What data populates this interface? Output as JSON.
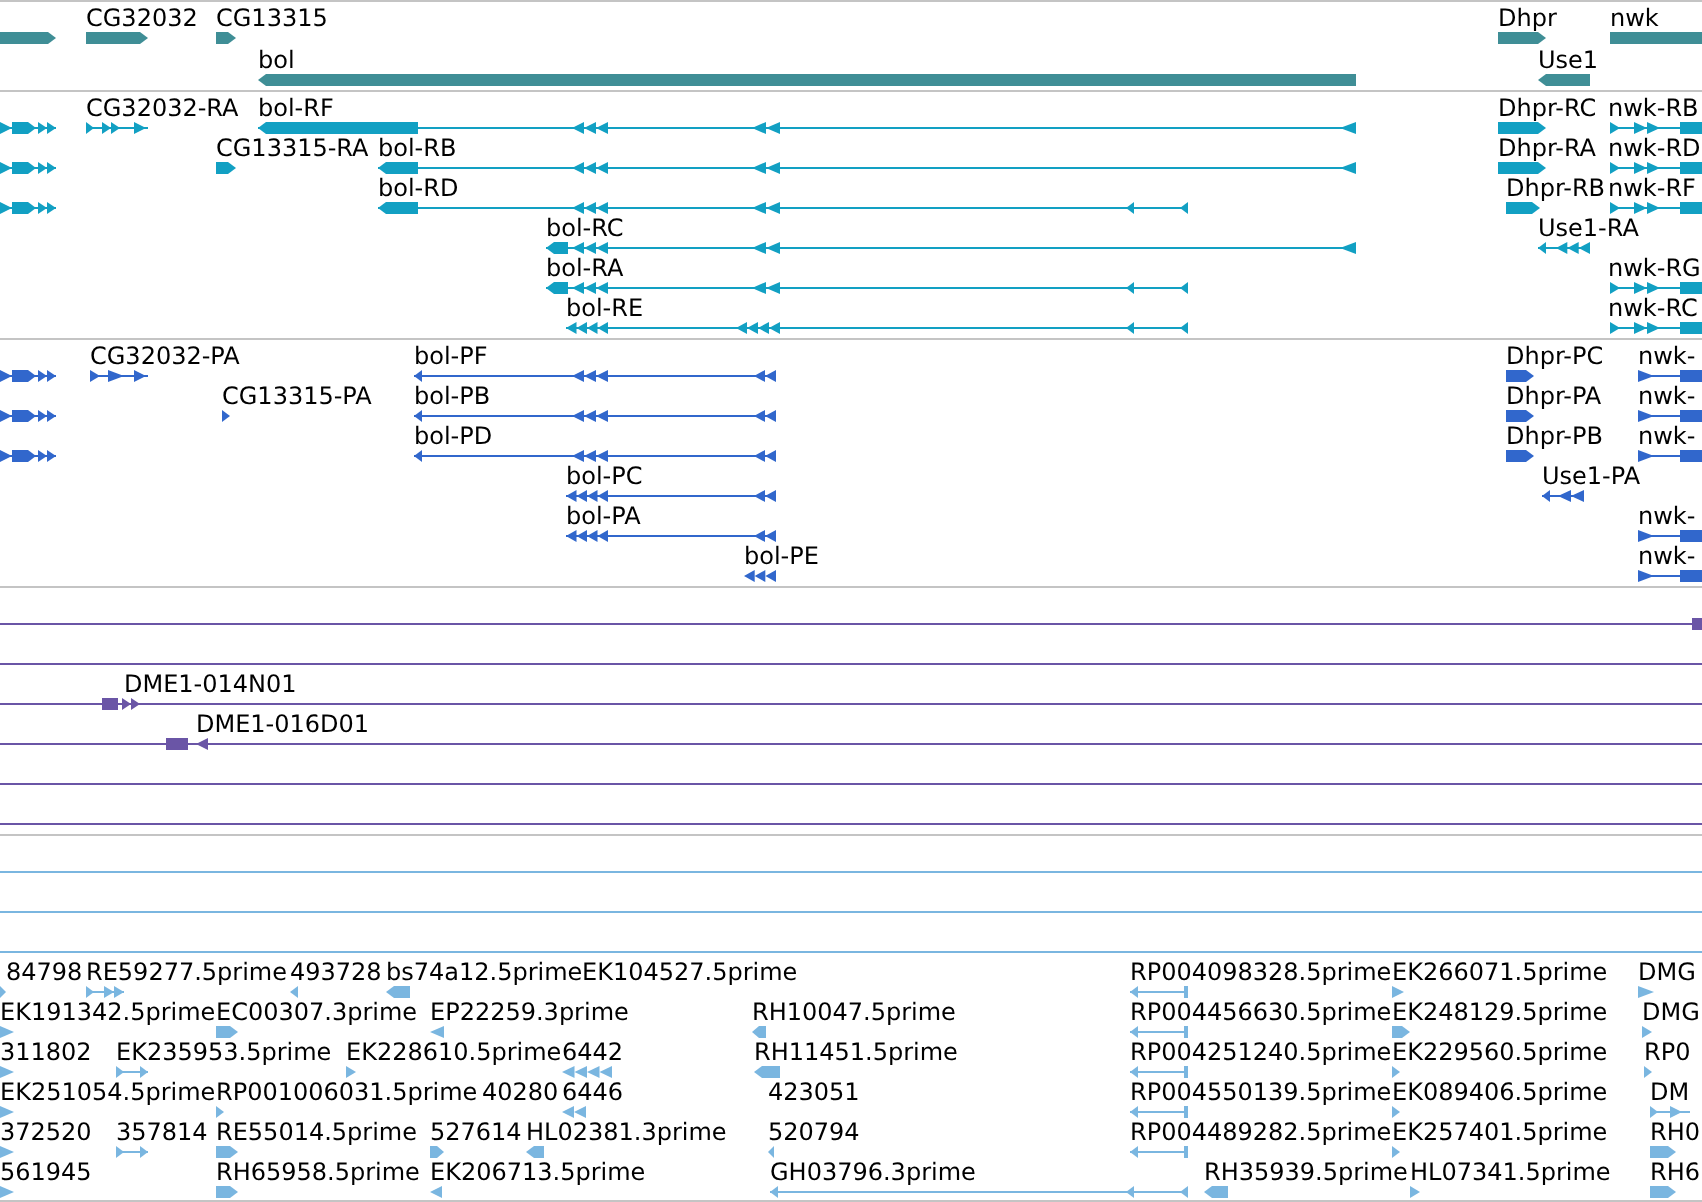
{
  "tracks": [
    {
      "color": "#3f8e96",
      "rows": [
        {
          "features": [
            {
              "reverse": false
            },
            {
              "label": "CG32032",
              "reverse": false
            },
            {
              "label": "CG13315",
              "reverse": false
            },
            {
              "label": "Dhpr",
              "reverse": false
            },
            {
              "label": "nwk",
              "reverse": false
            }
          ]
        },
        {
          "features": [
            {
              "label": "bol",
              "reverse": true
            },
            {
              "label": "Use1",
              "reverse": true
            }
          ]
        }
      ]
    },
    {
      "color": "#12a0c3",
      "rows": [
        {
          "features": [
            {
              "reverse": false
            },
            {
              "label": "CG32032-RA",
              "reverse": false
            },
            {
              "label": "bol-RF",
              "reverse": true
            },
            {
              "label": "Dhpr-RC",
              "reverse": false
            },
            {
              "label": "nwk-RB",
              "reverse": false
            }
          ]
        },
        {
          "features": [
            {
              "reverse": false
            },
            {
              "label": "CG13315-RA",
              "reverse": false
            },
            {
              "label": "bol-RB",
              "reverse": true
            },
            {
              "label": "Dhpr-RA",
              "reverse": false
            },
            {
              "label": "nwk-RD",
              "reverse": false
            }
          ]
        },
        {
          "features": [
            {
              "reverse": false
            },
            {
              "label": "bol-RD",
              "reverse": true
            },
            {
              "label": "Dhpr-RB",
              "reverse": false
            },
            {
              "label": "nwk-RF",
              "reverse": false
            }
          ]
        },
        {
          "features": [
            {
              "label": "bol-RC",
              "reverse": true
            },
            {
              "label": "Use1-RA",
              "reverse": true
            }
          ]
        },
        {
          "features": [
            {
              "label": "bol-RA",
              "reverse": true
            },
            {
              "label": "nwk-RG",
              "reverse": false
            }
          ]
        },
        {
          "features": [
            {
              "label": "bol-RE",
              "reverse": true
            },
            {
              "label": "nwk-RC",
              "reverse": false
            }
          ]
        }
      ]
    },
    {
      "color": "#3167cc",
      "rows": [
        {
          "features": [
            {
              "reverse": false
            },
            {
              "label": "CG32032-PA",
              "reverse": false
            },
            {
              "label": "bol-PF",
              "reverse": true
            },
            {
              "label": "Dhpr-PC",
              "reverse": false
            },
            {
              "label": "nwk-",
              "reverse": false
            }
          ]
        },
        {
          "features": [
            {
              "reverse": false
            },
            {
              "label": "CG13315-PA",
              "reverse": false
            },
            {
              "label": "bol-PB",
              "reverse": true
            },
            {
              "label": "Dhpr-PA",
              "reverse": false
            },
            {
              "label": "nwk-",
              "reverse": false
            }
          ]
        },
        {
          "features": [
            {
              "reverse": false
            },
            {
              "label": "bol-PD",
              "reverse": true
            },
            {
              "label": "Dhpr-PB",
              "reverse": false
            },
            {
              "label": "nwk-",
              "reverse": false
            }
          ]
        },
        {
          "features": [
            {
              "label": "bol-PC",
              "reverse": true
            },
            {
              "label": "Use1-PA",
              "reverse": true
            }
          ]
        },
        {
          "features": [
            {
              "label": "bol-PA",
              "reverse": true
            },
            {
              "label": "nwk-",
              "reverse": false
            }
          ]
        },
        {
          "features": [
            {
              "label": "bol-PE",
              "reverse": true
            },
            {
              "label": "nwk-",
              "reverse": false
            }
          ]
        }
      ]
    },
    {
      "color": "#6a55a6",
      "rows": [
        {
          "features": [
            {
              "kind": "spanning"
            }
          ]
        },
        {
          "features": [
            {
              "kind": "spanning"
            }
          ]
        },
        {
          "features": [
            {
              "kind": "spanning"
            },
            {
              "kind": "feature",
              "label": "DME1-014N01",
              "reverse": false
            }
          ]
        },
        {
          "features": [
            {
              "kind": "spanning"
            },
            {
              "kind": "feature",
              "label": "DME1-016D01",
              "reverse": true
            }
          ]
        },
        {
          "features": [
            {
              "kind": "spanning"
            }
          ]
        },
        {
          "features": [
            {
              "kind": "spanning"
            }
          ]
        }
      ]
    },
    {
      "color": "#7ab6e0",
      "rows": [
        {
          "features": [
            {
              "kind": "spanning"
            }
          ]
        },
        {
          "features": [
            {
              "kind": "spanning"
            }
          ]
        },
        {
          "features": [
            {
              "kind": "spanning"
            }
          ]
        },
        {
          "features": [
            {
              "kind": "feature",
              "label": "84798",
              "reverse": false
            },
            {
              "kind": "feature",
              "label": "RE59277.5prime",
              "reverse": false
            },
            {
              "kind": "feature",
              "label": "493728",
              "reverse": true
            },
            {
              "kind": "feature",
              "label": "bs74a12.5prime",
              "reverse": true
            },
            {
              "kind": "feature",
              "label": "EK104527.5prime"
            },
            {
              "kind": "feature",
              "label": "RP004098328.5prime",
              "reverse": true
            },
            {
              "kind": "feature",
              "label": "EK266071.5prime",
              "reverse": false
            },
            {
              "kind": "feature",
              "label": "DMG",
              "reverse": false
            }
          ]
        },
        {
          "features": [
            {
              "kind": "feature",
              "label": "EK191342.5prime",
              "reverse": false
            },
            {
              "kind": "feature",
              "label": "EC00307.3prime",
              "reverse": false
            },
            {
              "kind": "feature",
              "label": "EP22259.3prime",
              "reverse": true
            },
            {
              "kind": "feature",
              "label": "RH10047.5prime",
              "reverse": true
            },
            {
              "kind": "feature",
              "label": "RP004456630.5prime",
              "reverse": true
            },
            {
              "kind": "feature",
              "label": "EK248129.5prime",
              "reverse": false
            },
            {
              "kind": "feature",
              "label": "DMG",
              "reverse": false
            }
          ]
        },
        {
          "features": [
            {
              "kind": "feature",
              "label": "311802",
              "reverse": false
            },
            {
              "kind": "feature",
              "label": "EK235953.5prime",
              "reverse": false
            },
            {
              "kind": "feature",
              "label": "EK228610.5prime",
              "reverse": false
            },
            {
              "kind": "feature",
              "label": "6442",
              "reverse": true
            },
            {
              "kind": "feature",
              "label": "RH11451.5prime",
              "reverse": true
            },
            {
              "kind": "feature",
              "label": "RP004251240.5prime",
              "reverse": true
            },
            {
              "kind": "feature",
              "label": "EK229560.5prime",
              "reverse": false
            },
            {
              "kind": "feature",
              "label": "RP0",
              "reverse": false
            }
          ]
        },
        {
          "features": [
            {
              "kind": "feature",
              "label": "EK251054.5prime",
              "reverse": false
            },
            {
              "kind": "feature",
              "label": "RP001006031.5prime",
              "reverse": false
            },
            {
              "kind": "feature",
              "label": "40280"
            },
            {
              "kind": "feature",
              "label": "6446",
              "reverse": true
            },
            {
              "kind": "feature",
              "label": "423051"
            },
            {
              "kind": "feature",
              "label": "RP004550139.5prime",
              "reverse": true
            },
            {
              "kind": "feature",
              "label": "EK089406.5prime",
              "reverse": false
            },
            {
              "kind": "feature",
              "label": "DM",
              "reverse": false
            }
          ]
        },
        {
          "features": [
            {
              "kind": "feature",
              "label": "372520",
              "reverse": false
            },
            {
              "kind": "feature",
              "label": "357814",
              "reverse": false
            },
            {
              "kind": "feature",
              "label": "RE55014.5prime",
              "reverse": false
            },
            {
              "kind": "feature",
              "label": "527614",
              "reverse": false
            },
            {
              "kind": "feature",
              "label": "HL02381.3prime",
              "reverse": true
            },
            {
              "kind": "feature",
              "label": "520794",
              "reverse": true
            },
            {
              "kind": "feature",
              "label": "RP004489282.5prime",
              "reverse": true
            },
            {
              "kind": "feature",
              "label": "EK257401.5prime",
              "reverse": false
            },
            {
              "kind": "feature",
              "label": "RH0",
              "reverse": false
            }
          ]
        },
        {
          "features": [
            {
              "kind": "feature",
              "label": "561945",
              "reverse": false
            },
            {
              "kind": "feature",
              "label": "RH65958.5prime",
              "reverse": false
            },
            {
              "kind": "feature",
              "label": "EK206713.5prime",
              "reverse": true
            },
            {
              "kind": "feature",
              "label": "GH03796.3prime",
              "reverse": true
            },
            {
              "kind": "feature",
              "label": "RH35939.5prime",
              "reverse": true
            },
            {
              "kind": "feature",
              "label": "HL07341.5prime",
              "reverse": false
            },
            {
              "kind": "feature",
              "label": "RH6",
              "reverse": false
            }
          ]
        }
      ]
    }
  ]
}
